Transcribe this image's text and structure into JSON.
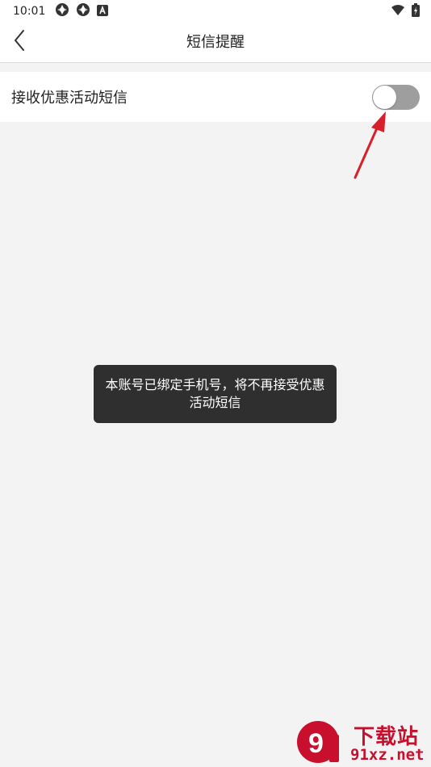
{
  "status_bar": {
    "time": "10:01",
    "left_icons": [
      "app-notification-icon",
      "app-notification-icon",
      "a-badge-icon"
    ],
    "right_icons": [
      "wifi-icon",
      "battery-icon"
    ]
  },
  "header": {
    "title": "短信提醒",
    "back_icon": "chevron-left-icon"
  },
  "settings": {
    "promo_sms": {
      "label": "接收优惠活动短信",
      "enabled": false
    }
  },
  "toast": {
    "message": "本账号已绑定手机号，将不再接受优惠活动短信"
  },
  "watermark": {
    "brand": "下载站",
    "domain": "91xz.net",
    "logo_text": "9"
  },
  "colors": {
    "background": "#f3f3f3",
    "toggle_off": "#9e9e9e",
    "toast_bg": "#2f2f2f",
    "arrow": "#d8202a",
    "watermark": "#c8102e"
  }
}
